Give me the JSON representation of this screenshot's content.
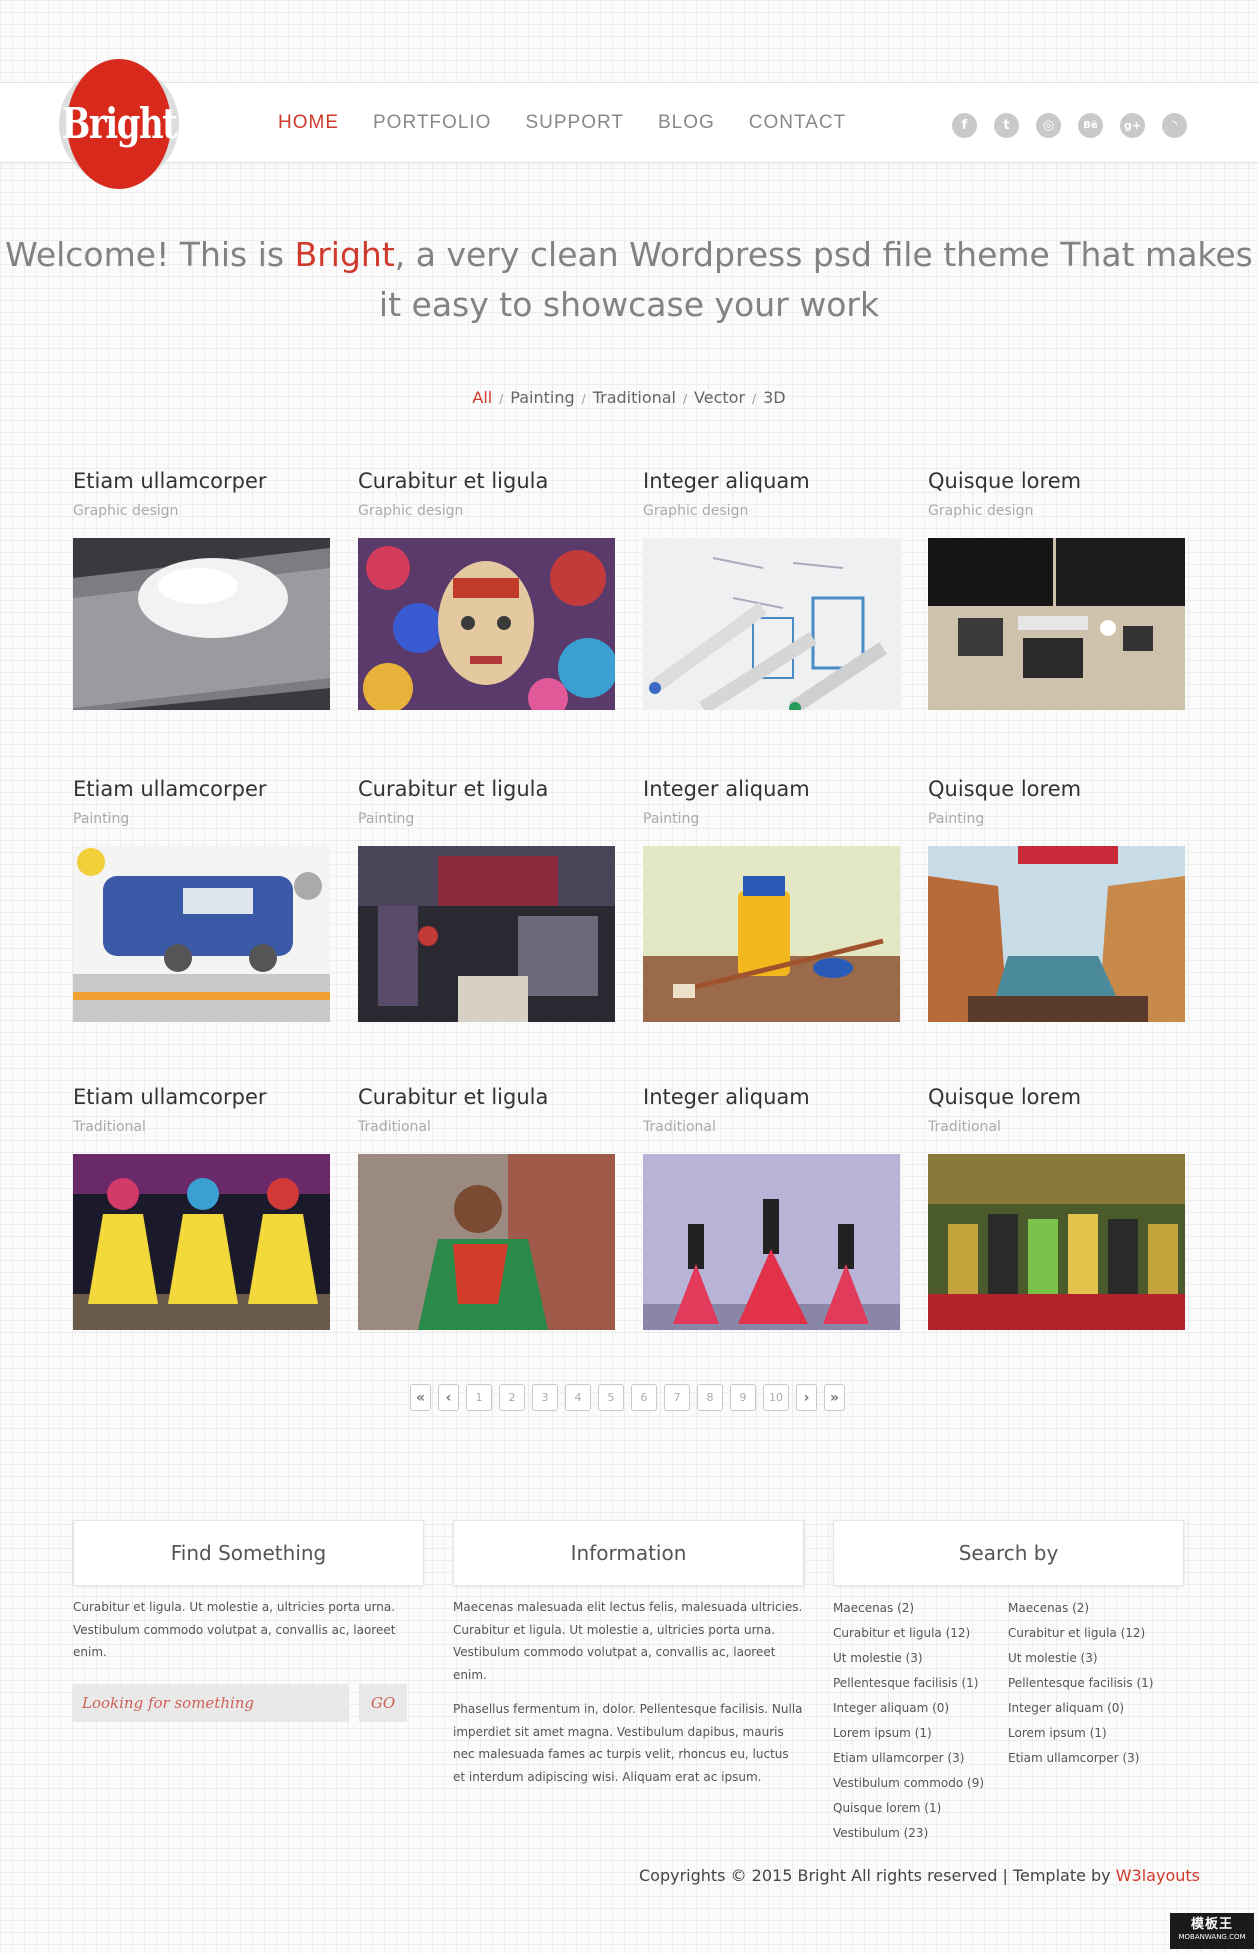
{
  "logo": {
    "text": "Bright"
  },
  "nav": [
    "HOME",
    "PORTFOLIO",
    "SUPPORT",
    "BLOG",
    "CONTACT"
  ],
  "social": [
    {
      "icon": "facebook-icon",
      "glyph": "f"
    },
    {
      "icon": "twitter-icon",
      "glyph": "t"
    },
    {
      "icon": "dribbble-icon",
      "glyph": "◎"
    },
    {
      "icon": "behance-icon",
      "glyph": "Bē"
    },
    {
      "icon": "googleplus-icon",
      "glyph": "g+"
    },
    {
      "icon": "rss-icon",
      "glyph": "◝"
    }
  ],
  "welcome": {
    "before": "Welcome! This is ",
    "brand": "Bright",
    "after": ", a very clean Wordpress psd file theme That makes it easy to showcase your work"
  },
  "filters": [
    "All",
    "Painting",
    "Traditional",
    "Vector",
    "3D"
  ],
  "portfolio": [
    [
      {
        "title": "Etiam ullamcorper",
        "category": "Graphic design",
        "image": "mouse-on-laptop"
      },
      {
        "title": "Curabitur et ligula",
        "category": "Graphic design",
        "image": "floral-face-painting"
      },
      {
        "title": "Integer aliquam",
        "category": "Graphic design",
        "image": "markers-sketch"
      },
      {
        "title": "Quisque lorem",
        "category": "Graphic design",
        "image": "desk-workstation"
      }
    ],
    [
      {
        "title": "Etiam ullamcorper",
        "category": "Painting",
        "image": "kids-bus-drawing"
      },
      {
        "title": "Curabitur et ligula",
        "category": "Painting",
        "image": "graffiti-wall"
      },
      {
        "title": "Integer aliquam",
        "category": "Painting",
        "image": "paint-jar-brush"
      },
      {
        "title": "Quisque lorem",
        "category": "Painting",
        "image": "canal-city-painting"
      }
    ],
    [
      {
        "title": "Etiam ullamcorper",
        "category": "Traditional",
        "image": "dancers-yellow"
      },
      {
        "title": "Curabitur et ligula",
        "category": "Traditional",
        "image": "indian-dancer"
      },
      {
        "title": "Integer aliquam",
        "category": "Traditional",
        "image": "dancers-red-skirts"
      },
      {
        "title": "Quisque lorem",
        "category": "Traditional",
        "image": "wedding-group"
      }
    ]
  ],
  "pagination": [
    "«",
    "‹",
    "1",
    "2",
    "3",
    "4",
    "5",
    "6",
    "7",
    "8",
    "9",
    "10",
    "›",
    "»"
  ],
  "footer": {
    "find": {
      "title": "Find Something",
      "text": "Curabitur et ligula. Ut molestie a, ultricies porta urna. Vestibulum commodo volutpat a, convallis ac, laoreet enim.",
      "placeholder": "Looking for something",
      "button": "GO"
    },
    "info": {
      "title": "Information",
      "p1": "Maecenas malesuada elit lectus felis, malesuada ultricies. Curabitur et ligula. Ut molestie a, ultricies porta urna. Vestibulum commodo volutpat a, convallis ac, laoreet enim.",
      "p2": "Phasellus fermentum in, dolor. Pellentesque facilisis. Nulla imperdiet sit amet magna. Vestibulum dapibus, mauris nec malesuada fames ac turpis velit, rhoncus eu, luctus et interdum adipiscing wisi. Aliquam erat ac ipsum."
    },
    "search_by": {
      "title": "Search by",
      "col1": [
        "Maecenas (2)",
        "Curabitur et ligula (12)",
        "Ut molestie (3)",
        "Pellentesque facilisis (1)",
        "Integer aliquam (0)",
        "Lorem ipsum (1)",
        "Etiam ullamcorper (3)",
        "Vestibulum commodo (9)",
        "Quisque lorem (1)",
        "Vestibulum (23)"
      ],
      "col2": [
        "Maecenas (2)",
        "Curabitur et ligula (12)",
        "Ut molestie (3)",
        "Pellentesque facilisis (1)",
        "Integer aliquam (0)",
        "Lorem ipsum (1)",
        "Etiam ullamcorper (3)"
      ]
    }
  },
  "copyright": {
    "text": "Copyrights © 2015 Bright All rights reserved | Template by ",
    "link": "W3layouts"
  },
  "badge": {
    "line1": "模板王",
    "line2": "MOBANWANG.COM"
  }
}
